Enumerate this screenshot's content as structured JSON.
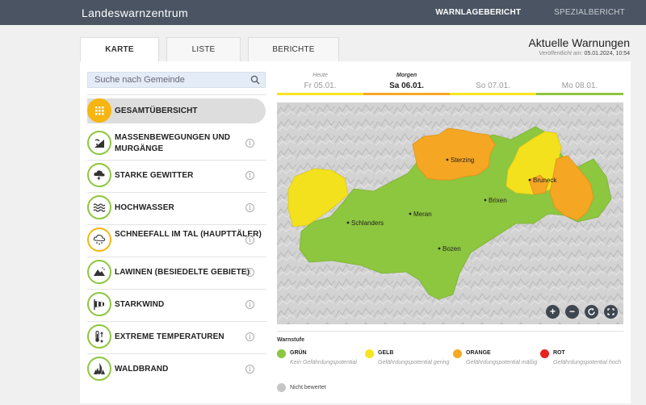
{
  "app_title": "Landeswarnzentrum",
  "topnav": [
    "WARNLAGEBERICHT",
    "SPEZIALBERICHT"
  ],
  "tabs": [
    "KARTE",
    "LISTE",
    "BERICHTE"
  ],
  "heading": "Aktuelle Warnungen",
  "published_label": "Veröffentlicht am:",
  "published_value": "05.01.2024, 10:54",
  "search": {
    "placeholder": "Suche nach Gemeinde"
  },
  "categories": [
    {
      "label": "GESAMTÜBERSICHT",
      "icon": "grid-icon"
    },
    {
      "label": "MASSENBEWEGUNGEN UND MURGÄNGE",
      "icon": "landslide-icon"
    },
    {
      "label": "STARKE GEWITTER",
      "icon": "thunderstorm-icon"
    },
    {
      "label": "HOCHWASSER",
      "icon": "flood-icon"
    },
    {
      "label": "SCHNEEFALL IM TAL (HAUPTTÄLER)",
      "icon": "snowfall-icon"
    },
    {
      "label": "LAWINEN (BESIEDELTE GEBIETE)",
      "icon": "avalanche-icon"
    },
    {
      "label": "STARKWIND",
      "icon": "windsock-icon"
    },
    {
      "label": "EXTREME TEMPERATUREN",
      "icon": "thermometer-icon"
    },
    {
      "label": "WALDBRAND",
      "icon": "forest-fire-icon"
    }
  ],
  "days": [
    {
      "rel": "Heute",
      "label": "Fr 05.01.",
      "color": "#f7e41f"
    },
    {
      "rel": "Morgen",
      "label": "Sa 06.01.",
      "color": "#f7a823"
    },
    {
      "rel": "",
      "label": "So 07.01.",
      "color": "#f7e41f"
    },
    {
      "rel": "",
      "label": "Mo 08.01.",
      "color": "#8dc63f"
    }
  ],
  "map": {
    "places": [
      "Sterzing",
      "Bruneck",
      "Brixen",
      "Schlanders",
      "Meran",
      "Bozen"
    ],
    "controls": [
      "zoom-in-icon",
      "zoom-out-icon",
      "reset-icon",
      "fullscreen-icon"
    ]
  },
  "legend": {
    "title": "Warnstufe",
    "levels": [
      {
        "name": "GRÜN",
        "desc": "Kein Gefährdungspotential",
        "color": "#8dc63f"
      },
      {
        "name": "GELB",
        "desc": "Gefährdungspotential gering",
        "color": "#f7e41f"
      },
      {
        "name": "ORANGE",
        "desc": "Gefährdungspotential mäßig",
        "color": "#f7a823"
      },
      {
        "name": "ROT",
        "desc": "Gefährdungspotential hoch",
        "color": "#e8231f"
      }
    ],
    "not_rated": "Nicht bewertet"
  }
}
